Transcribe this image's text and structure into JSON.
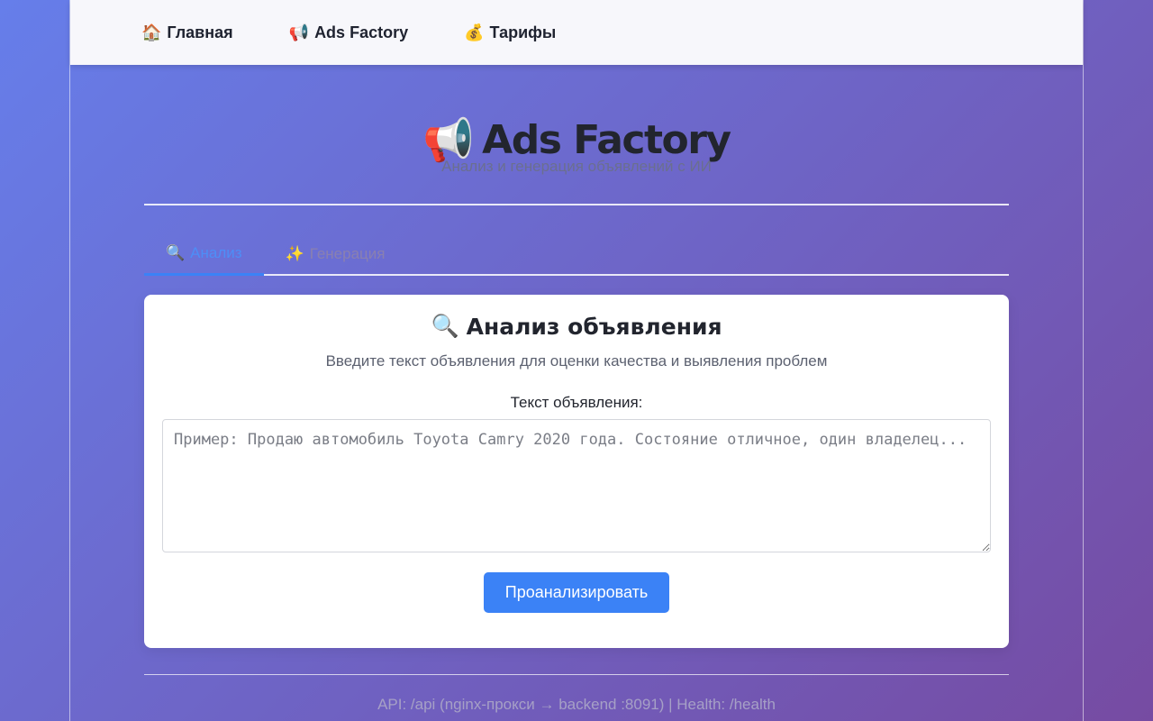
{
  "nav": {
    "items": [
      {
        "icon": "🏠",
        "label": "Главная"
      },
      {
        "icon": "📢",
        "label": "Ads Factory"
      },
      {
        "icon": "💰",
        "label": "Тарифы"
      }
    ]
  },
  "hero": {
    "icon": "📢",
    "title": "Ads Factory",
    "subtitle": "Анализ и генерация объявлений с ИИ"
  },
  "tabs": [
    {
      "icon": "🔍",
      "label": "Анализ",
      "active": true
    },
    {
      "icon": "✨",
      "label": "Генерация",
      "active": false
    }
  ],
  "card": {
    "icon": "🔍",
    "title": "Анализ объявления",
    "description": "Введите текст объявления для оценки качества и выявления проблем",
    "field_label": "Текст объявления:",
    "placeholder": "Пример: Продаю автомобиль Toyota Camry 2020 года. Состояние отличное, один владелец...",
    "value": "",
    "submit_label": "Проанализировать"
  },
  "footer": {
    "text": "API: /api (nginx-прокси → backend :8091) | Health: /health"
  },
  "colors": {
    "accent": "#3b82f6",
    "gradient_start": "#667eea",
    "gradient_end": "#764ba2"
  }
}
